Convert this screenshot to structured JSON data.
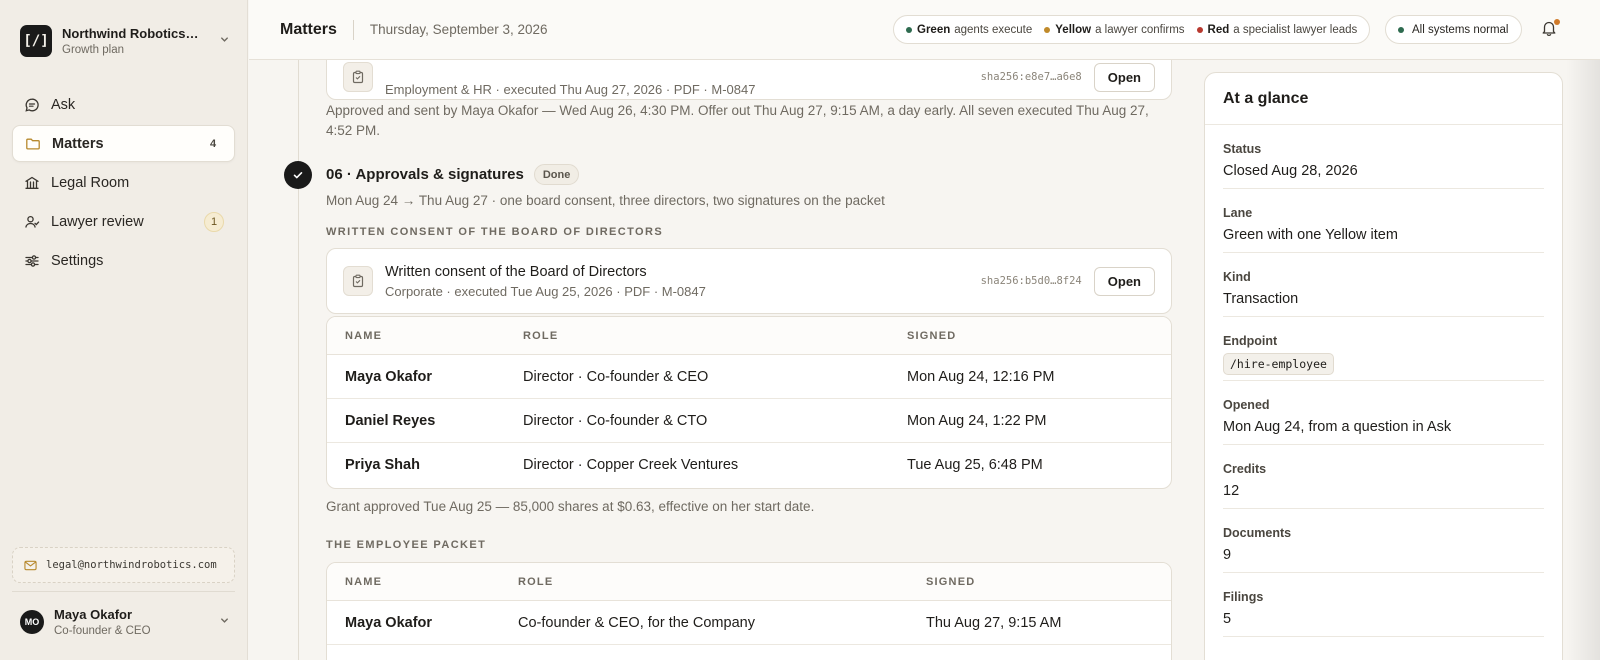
{
  "org": {
    "logo": "[/]",
    "name": "Northwind Robotics, Inc.",
    "plan": "Growth plan"
  },
  "nav": [
    {
      "label": "Ask",
      "icon": "chat-icon",
      "badge": ""
    },
    {
      "label": "Matters",
      "icon": "folder-icon",
      "badge": "4"
    },
    {
      "label": "Legal Room",
      "icon": "building-icon",
      "badge": ""
    },
    {
      "label": "Lawyer review",
      "icon": "user-check-icon",
      "badge": "1"
    },
    {
      "label": "Settings",
      "icon": "sliders-icon",
      "badge": ""
    }
  ],
  "sidebar_footer": {
    "email": "legal@northwindrobotics.com",
    "user_initials": "MO",
    "user_name": "Maya Okafor",
    "user_role": "Co-founder & CEO"
  },
  "topbar": {
    "title": "Matters",
    "date": "Thursday, September 3, 2026",
    "legend": [
      {
        "bold": "Green",
        "text": "agents execute",
        "color": "#2e6b4f"
      },
      {
        "bold": "Yellow",
        "text": "a lawyer confirms",
        "color": "#c08a2a"
      },
      {
        "bold": "Red",
        "text": "a specialist lawyer leads",
        "color": "#b8392f"
      }
    ],
    "system_status": "All systems normal"
  },
  "main": {
    "prev_doc": {
      "subtitle": "Employment & HR · executed Thu Aug 27, 2026 · PDF · M-0847",
      "hash": "sha256:e8e7…a6e8",
      "open_label": "Open"
    },
    "prev_note": "Approved and sent by Maya Okafor — Wed Aug 26, 4:30 PM. Offer out Thu Aug 27, 9:15 AM, a day early. All seven executed Thu Aug 27, 4:52 PM.",
    "step": {
      "title": "06 · Approvals & signatures",
      "status": "Done",
      "summary": "Mon Aug 24 → Thu Aug 27 · one board consent, three directors, two signatures on the packet"
    },
    "consent_section": {
      "label": "WRITTEN CONSENT OF THE BOARD OF DIRECTORS",
      "doc": {
        "title": "Written consent of the Board of Directors",
        "subtitle": "Corporate · executed Tue Aug 25, 2026 · PDF · M-0847",
        "hash": "sha256:b5d0…8f24",
        "open_label": "Open"
      },
      "columns": [
        "NAME",
        "ROLE",
        "SIGNED"
      ],
      "rows": [
        {
          "name": "Maya Okafor",
          "role": "Director · Co-founder & CEO",
          "signed": "Mon Aug 24, 12:16 PM"
        },
        {
          "name": "Daniel Reyes",
          "role": "Director · Co-founder & CTO",
          "signed": "Mon Aug 24, 1:22 PM"
        },
        {
          "name": "Priya Shah",
          "role": "Director · Copper Creek Ventures",
          "signed": "Tue Aug 25, 6:48 PM"
        }
      ],
      "note": "Grant approved Tue Aug 25 — 85,000 shares at $0.63, effective on her start date."
    },
    "packet_section": {
      "label": "THE EMPLOYEE PACKET",
      "columns": [
        "NAME",
        "ROLE",
        "SIGNED"
      ],
      "rows": [
        {
          "name": "Maya Okafor",
          "role": "Co-founder & CEO, for the Company",
          "signed": "Thu Aug 27, 9:15 AM"
        },
        {
          "name": "",
          "role": "",
          "signed": ""
        }
      ]
    }
  },
  "glance": {
    "title": "At a glance",
    "items": [
      {
        "label": "Status",
        "value": "Closed Aug 28, 2026"
      },
      {
        "label": "Lane",
        "value": "Green with one Yellow item"
      },
      {
        "label": "Kind",
        "value": "Transaction"
      },
      {
        "label": "Endpoint",
        "value": "/hire-employee"
      },
      {
        "label": "Opened",
        "value": "Mon Aug 24, from a question in Ask"
      },
      {
        "label": "Credits",
        "value": "12"
      },
      {
        "label": "Documents",
        "value": "9"
      },
      {
        "label": "Filings",
        "value": "5"
      }
    ]
  }
}
